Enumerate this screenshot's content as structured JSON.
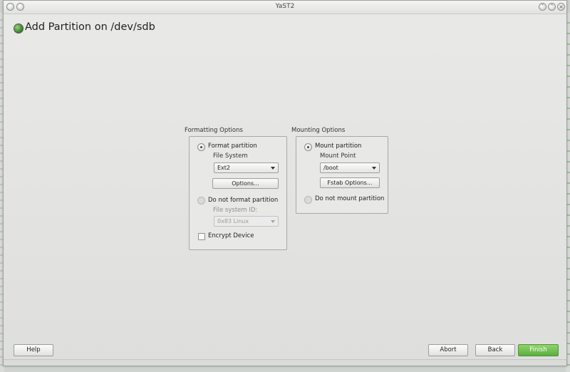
{
  "window": {
    "title": "YaST2"
  },
  "header": {
    "title": "Add Partition on /dev/sdb"
  },
  "formatting": {
    "group_label": "Formatting Options",
    "format_partition_label": "Format partition",
    "file_system_label": "File System",
    "file_system_value": "Ext2",
    "options_button": "Options...",
    "do_not_format_label": "Do not format partition",
    "file_system_id_label": "File system ID:",
    "file_system_id_value": "0x83 Linux",
    "encrypt_label": "Encrypt Device"
  },
  "mounting": {
    "group_label": "Mounting Options",
    "mount_partition_label": "Mount partition",
    "mount_point_label": "Mount Point",
    "mount_point_value": "/boot",
    "fstab_button": "Fstab Options...",
    "do_not_mount_label": "Do not mount partition"
  },
  "footer": {
    "help": "Help",
    "abort": "Abort",
    "back": "Back",
    "finish": "Finish"
  },
  "state": {
    "format_selected": true,
    "mount_selected": true,
    "encrypt_checked": false
  },
  "colors": {
    "finish_button": "#6cbd4b",
    "accent": "#3f8a2f"
  }
}
